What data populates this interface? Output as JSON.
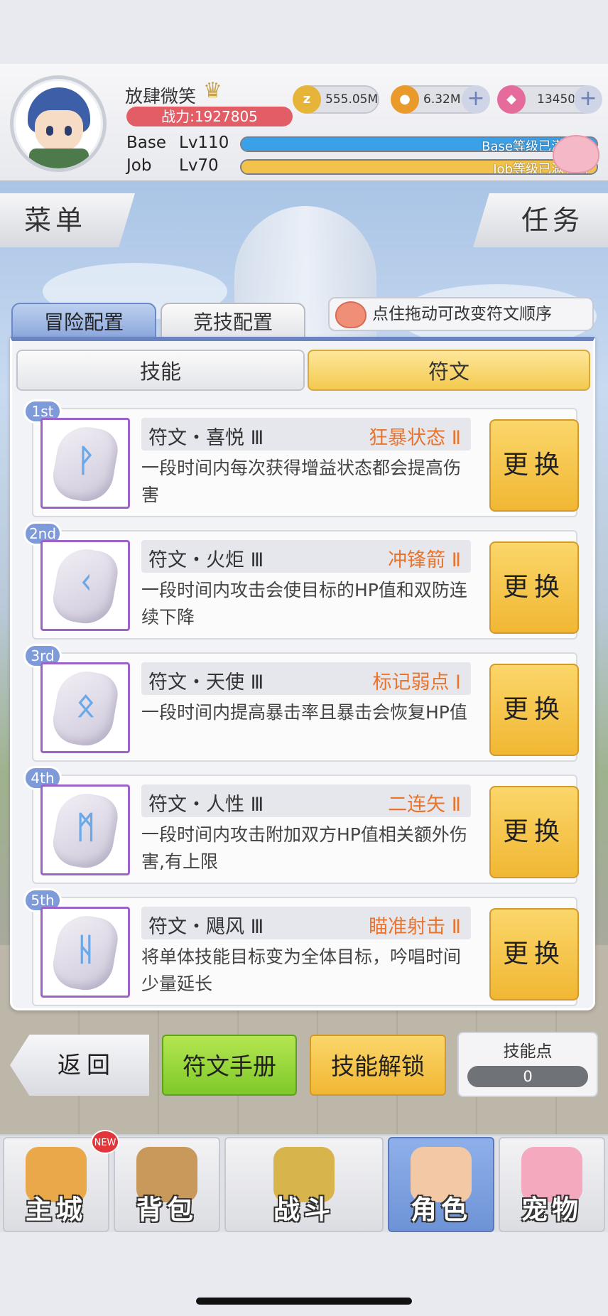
{
  "player": {
    "name": "放肆微笑",
    "power": "战力:1927805"
  },
  "currencies": [
    {
      "icon": "zeny-coin-icon",
      "value": "555.05M",
      "color": "#e7b43a"
    },
    {
      "icon": "gold-poring-coin-icon",
      "value": "6.32M",
      "color": "#e99a2a"
    },
    {
      "icon": "pink-crystal-icon",
      "value": "13450",
      "color": "#e46b9c"
    }
  ],
  "levels": {
    "base_label": "Base",
    "base_level": "Lv110",
    "base_status": "Base等级已满，可",
    "base_fill": 1.0,
    "base_color": "#3aa0e8",
    "job_label": "Job",
    "job_level": "Lv70",
    "job_status": "Job等级已满，可",
    "job_fill": 1.0,
    "job_color": "#f2c24b"
  },
  "side": {
    "menu": "菜单",
    "task": "任务"
  },
  "config_tabs": {
    "adventure": "冒险配置",
    "arena": "竞技配置"
  },
  "tip": "点住拖动可改变符文顺序",
  "sub_tabs": {
    "skill": "技能",
    "rune": "符文"
  },
  "runes": [
    {
      "rank": "1st",
      "name": "符文・喜悦 Ⅲ",
      "skill": "狂暴状态 Ⅱ",
      "desc": "一段时间内每次获得增益状态都会提高伤害",
      "glyph": "ᚹ",
      "button": "更换"
    },
    {
      "rank": "2nd",
      "name": "符文・火炬 Ⅲ",
      "skill": "冲锋箭 Ⅱ",
      "desc": "一段时间内攻击会使目标的HP值和双防连续下降",
      "glyph": "ᚲ",
      "button": "更换"
    },
    {
      "rank": "3rd",
      "name": "符文・天使 Ⅲ",
      "skill": "标记弱点 Ⅰ",
      "desc": "一段时间内提高暴击率且暴击会恢复HP值",
      "glyph": "ᛟ",
      "button": "更换"
    },
    {
      "rank": "4th",
      "name": "符文・人性 Ⅲ",
      "skill": "二连矢 Ⅱ",
      "desc": "一段时间内攻击附加双方HP值相关额外伤害,有上限",
      "glyph": "ᛗ",
      "button": "更换"
    },
    {
      "rank": "5th",
      "name": "符文・飓风 Ⅲ",
      "skill": "瞄准射击 Ⅱ",
      "desc": "将单体技能目标变为全体目标，吟唱时间少量延长",
      "glyph": "ᚺ",
      "button": "更换"
    }
  ],
  "actions": {
    "back": "返回",
    "manual": "符文手册",
    "unlock": "技能解锁",
    "points_label": "技能点",
    "points_value": "0"
  },
  "nav": [
    {
      "label": "主城",
      "icon": "castle-icon",
      "color": "#e9a94a",
      "active": false
    },
    {
      "label": "背包",
      "icon": "backpack-icon",
      "color": "#c9995c",
      "active": false
    },
    {
      "label": "战斗",
      "icon": "crossed-swords-icon",
      "color": "#d8b44c",
      "active": false
    },
    {
      "label": "角色",
      "icon": "character-icon",
      "color": "#f2c9a4",
      "active": true
    },
    {
      "label": "宠物",
      "icon": "poring-pet-icon",
      "color": "#f4a9bf",
      "active": false
    }
  ],
  "new_badge": "NEW"
}
